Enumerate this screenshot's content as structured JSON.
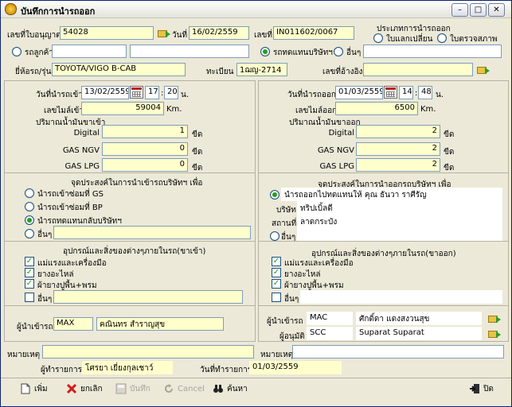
{
  "window": {
    "title": "บันทึกการนำรถออก"
  },
  "header": {
    "license_label": "เลขที่ใบอนุญาต",
    "license_value": "54028",
    "date_label": "วันที่",
    "date_value": "16/02/2559",
    "doc_no_label": "เลขที่",
    "doc_no_value": "IN011602/0067",
    "exit_type_label": "ประเภทการนำรถออก",
    "exit_type_options": [
      "ใบแลกเปลี่ยน",
      "ใบตรวจสภาพ"
    ],
    "car_type_options": [
      "รถลูกค้า",
      "รถทดแทนบริษัทฯ",
      "อื่นๆ"
    ],
    "brand_label": "ยี่ห้อรถ/รุ่น",
    "brand_value": "TOYOTA/VIGO B-CAB",
    "plate_label": "ทะเบียน",
    "plate_value": "1ฌญ-2714",
    "ref_label": "เลขที่อ้างอิง",
    "ref_value": ""
  },
  "in_section": {
    "time_label": "วันที่นำรถเข้า",
    "date": "13/02/2559",
    "hour": "17",
    "minute": "20",
    "time_unit": "น.",
    "mileage_label": "เลขไมล์เข้า",
    "mileage": "59004",
    "mileage_unit": "Km.",
    "fuel_label": "ปริมาณน้ำมันขาเข้า",
    "fuel": [
      {
        "label": "Digital",
        "value": "1",
        "unit": "ขีด"
      },
      {
        "label": "GAS NGV",
        "value": "0",
        "unit": "ขีด"
      },
      {
        "label": "GAS LPG",
        "value": "0",
        "unit": "ขีด"
      }
    ],
    "purpose_title": "จุดประสงค์ในการนำเข้ารถบริษัทฯ เพื่อ",
    "purpose_options": [
      "นำรถเข้าซ่อมที่ GS",
      "นำรถเข้าซ่อมที่ BP",
      "นำรถทดแทนกลับบริษัทฯ",
      "อื่นๆ"
    ],
    "equip_title": "อุปกรณ์และสิ่งของต่างๆภายในรถ(ขาเข้า)",
    "equip_items": [
      "แม่แรงและเครื่องมือ",
      "ยางอะไหล่",
      "ผ้ายางปูพื้น+พรม",
      "อื่นๆ"
    ],
    "person_label": "ผู้นำเข้ารถ",
    "person_code": "MAX",
    "person_name": "คณินทร สำราญสุข"
  },
  "out_section": {
    "time_label": "วันที่นำรถออก",
    "date": "01/03/2559",
    "hour": "14",
    "minute": "48",
    "time_unit": "น.",
    "mileage_label": "เลขไมล์ออก",
    "mileage": "6500",
    "mileage_unit": "Km.",
    "fuel_label": "ปริมาณน้ำมันขาออก",
    "fuel": [
      {
        "label": "Digital",
        "value": "2",
        "unit": "ขีด"
      },
      {
        "label": "GAS NGV",
        "value": "2",
        "unit": "ขีด"
      },
      {
        "label": "GAS LPG",
        "value": "2",
        "unit": "ขีด"
      }
    ],
    "purpose_title": "จุดประสงค์ในการนำออกรถบริษัทฯ เพื่อ",
    "purpose_option1": "นำรถออกไปทดแทนให้ คุณ ธันวา ราศีรัญ",
    "company_label": "บริษัท",
    "company_value": "ทริปเบิ้ลดี",
    "place_label": "สถานที่",
    "place_value": "ลาดกระบัง",
    "other_label": "อื่นๆ",
    "equip_title": "อุปกรณ์และสิ่งของต่างๆภายในรถ(ขาออก)",
    "equip_items": [
      "แม่แรงและเครื่องมือ",
      "ยางอะไหล่",
      "ผ้ายางปูพื้น+พรม",
      "อื่นๆ"
    ],
    "person_label": "ผู้นำเข้ารถ",
    "person_code": "MAC",
    "person_name": "ศักดิ์ดา แดงสงวนสุข",
    "approver_label": "ผู้อนุมัติ",
    "approver_code": "SCC",
    "approver_name": "Suparat Suparat"
  },
  "remarks": {
    "label_left": "หมายเหตุ",
    "value_left": "",
    "label_right": "หมายเหตุ",
    "value_right": ""
  },
  "footer_info": {
    "operator_label": "ผู้ทำรายการ",
    "operator_value": "โศรยา เยี่ยงกุลเชาว์",
    "op_date_label": "วันที่ทำรายการ",
    "op_date_value": "01/03/2559"
  },
  "toolbar": {
    "add": "เพิ่ม",
    "cancel_doc": "ยกเลิก",
    "save": "บันทึก",
    "cancel": "Cancel",
    "search": "ค้นหา",
    "close": "ปิด"
  }
}
